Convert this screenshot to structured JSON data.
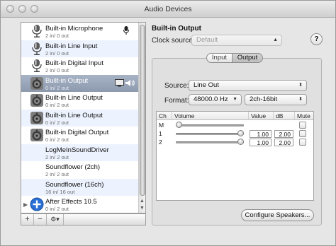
{
  "window": {
    "title": "Audio Devices"
  },
  "devices": [
    {
      "name": "Built-in Microphone",
      "io": "2 in/ 0 out",
      "icon": "microphone-icon",
      "tag": "microphone-icon"
    },
    {
      "name": "Built-in Line Input",
      "io": "2 in/ 0 out",
      "icon": "microphone-icon"
    },
    {
      "name": "Built-in Digital Input",
      "io": "2 in/ 0 out",
      "icon": "microphone-icon"
    },
    {
      "name": "Built-in Output",
      "io": "0 in/ 2 out",
      "icon": "speaker-icon",
      "tag": "speaker-icon",
      "selected": true
    },
    {
      "name": "Built-in Line Output",
      "io": "0 in/ 2 out",
      "icon": "speaker-icon"
    },
    {
      "name": "Built-in Line Output",
      "io": "0 in/ 2 out",
      "icon": "speaker-icon"
    },
    {
      "name": "Built-in Digital Output",
      "io": "0 in/ 2 out",
      "icon": "speaker-icon"
    },
    {
      "name": "LogMeInSoundDriver",
      "io": "2 in/ 2 out",
      "icon": "none"
    },
    {
      "name": "Soundflower (2ch)",
      "io": "2 in/ 2 out",
      "icon": "none"
    },
    {
      "name": "Soundflower (16ch)",
      "io": "16 in/ 16 out",
      "icon": "none"
    },
    {
      "name": "After Effects 10.5",
      "io": "0 in/ 2 out",
      "icon": "aggregate-icon"
    }
  ],
  "list_toolbar": {
    "add": "+",
    "remove": "−",
    "gear": "⚙▾"
  },
  "detail": {
    "title": "Built-in Output",
    "clock_label": "Clock source:",
    "clock_value": "Default",
    "help": "?",
    "tabs": [
      {
        "label": "Input",
        "active": false
      },
      {
        "label": "Output",
        "active": true
      }
    ],
    "source_label": "Source:",
    "source_value": "Line Out",
    "format_label": "Format:",
    "format_rate": "48000.0 Hz",
    "format_bits": "2ch-16bit",
    "table": {
      "headers": {
        "ch": "Ch",
        "volume": "Volume",
        "value": "Value",
        "db": "dB",
        "mute": "Mute"
      },
      "rows": [
        {
          "ch": "M",
          "value": "",
          "db": "",
          "level": 0.0
        },
        {
          "ch": "1",
          "value": "1.00",
          "db": "2.00",
          "level": 1.0
        },
        {
          "ch": "2",
          "value": "1.00",
          "db": "2.00",
          "level": 1.0
        }
      ]
    },
    "configure_label": "Configure Speakers..."
  },
  "colors": {
    "selection": "#98a5b8",
    "alt_row": "#edf3fe",
    "aggregate_blue": "#2a6fd6"
  }
}
